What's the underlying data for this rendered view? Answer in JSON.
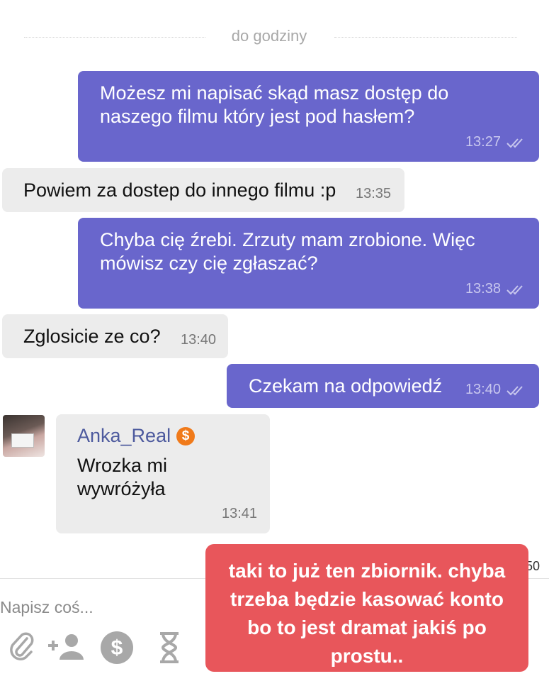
{
  "chat": {
    "date_divider": "do godziny",
    "messages": [
      {
        "text": "Możesz mi napisać skąd masz dostęp do\nnaszego filmu który jest pod hasłem?",
        "time": "13:27"
      },
      {
        "text": "Powiem za dostep do innego filmu :p",
        "time": "13:35"
      },
      {
        "text": "Chyba cię źrebi. Zrzuty mam zrobione. Więc\nmówisz czy cię zgłaszać?",
        "time": "13:38"
      },
      {
        "text": "Zglosicie ze co?",
        "time": "13:40"
      },
      {
        "text": "Czekam na odpowiedź",
        "time": "13:40"
      },
      {
        "sender": "Anka_Real",
        "sender_badge": "$",
        "text": "Wrozka mi\nwywróżyła",
        "time": "13:41"
      }
    ],
    "partial_time": "50"
  },
  "composer": {
    "placeholder": "Napisz coś...",
    "icons": [
      "paperclip-icon",
      "add-user-icon",
      "dollar-coin-icon",
      "hourglass-icon"
    ]
  },
  "overlay_note": {
    "text": "taki to już ten zbiornik. chyba\ntrzeba będzie kasować konto\nbo to jest dramat jakiś po\nprostu.."
  },
  "colors": {
    "outgoing_bubble": "#6966cc",
    "incoming_bubble": "#ececec",
    "overlay": "#e8565b",
    "sender_name": "#4d5a9e",
    "coin": "#f07a1a"
  }
}
